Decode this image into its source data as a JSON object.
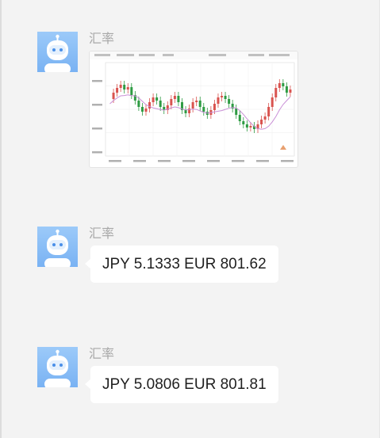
{
  "messages": [
    {
      "sender": "汇率",
      "type": "image",
      "image_desc": "exchange-rate-candlestick-chart"
    },
    {
      "sender": "汇率",
      "type": "text",
      "text": "JPY 5.1333 EUR 801.62"
    },
    {
      "sender": "汇率",
      "type": "text",
      "text": "JPY 5.0806 EUR 801.81"
    }
  ],
  "colors": {
    "background": "#f3f3f3",
    "bubble": "#ffffff",
    "avatar": "#8fc0f7",
    "sender_text": "#a8a8a8",
    "candle_up": "#d9534f",
    "candle_down": "#2e9b43",
    "ma_line": "#c98fd6"
  }
}
